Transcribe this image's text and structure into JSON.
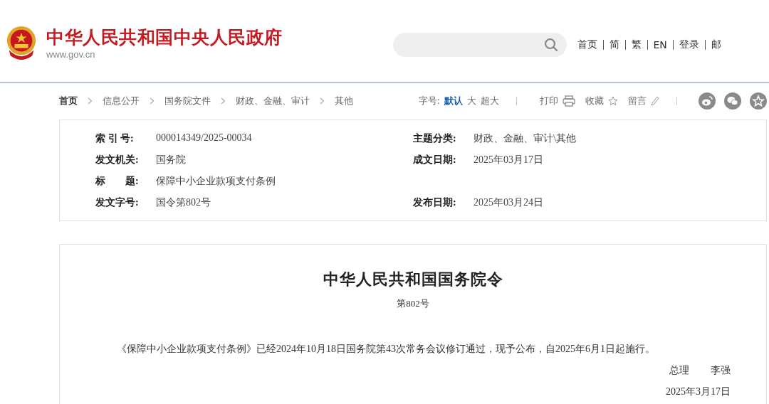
{
  "header": {
    "site_title": "中华人民共和国中央人民政府",
    "site_url": "www.gov.cn",
    "nav_links": [
      "首页",
      "简",
      "繁",
      "EN",
      "登录",
      "邮"
    ]
  },
  "breadcrumb": [
    "首页",
    "信息公开",
    "国务院文件",
    "财政、金融、审计",
    "其他"
  ],
  "toolbar": {
    "font_size_label": "字号:",
    "font_sizes": [
      {
        "label": "默认",
        "selected": true
      },
      {
        "label": "大",
        "selected": false
      },
      {
        "label": "超大",
        "selected": false
      }
    ],
    "actions": [
      {
        "label": "打印",
        "kind": "print"
      },
      {
        "label": "收藏",
        "kind": "star"
      },
      {
        "label": "留言",
        "kind": "pencil"
      }
    ],
    "share": [
      {
        "kind": "weibo"
      },
      {
        "kind": "wechat"
      },
      {
        "kind": "star"
      }
    ]
  },
  "metadata": [
    {
      "label": "索 引 号:",
      "value": "000014349/2025-00034",
      "label_2": "主题分类:",
      "value_2": "财政、金融、审计\\其他"
    },
    {
      "label": "发文机关:",
      "value": "国务院",
      "label_2": "成文日期:",
      "value_2": "2025年03月17日"
    },
    {
      "label": "标　　题:",
      "value": "保障中小企业款项支付条例"
    },
    {
      "label": "发文字号:",
      "value": "国令第802号",
      "label_2": "发布日期:",
      "value_2": "2025年03月24日"
    }
  ],
  "document": {
    "title": "中华人民共和国国务院令",
    "number": "第802号",
    "body": "《保障中小企业款项支付条例》已经2024年10月18日国务院第43次常务会议修订通过，现予公布，自2025年6月1日起施行。",
    "signer_title": "总理",
    "signer_name": "李强",
    "date": "2025年3月17日"
  }
}
